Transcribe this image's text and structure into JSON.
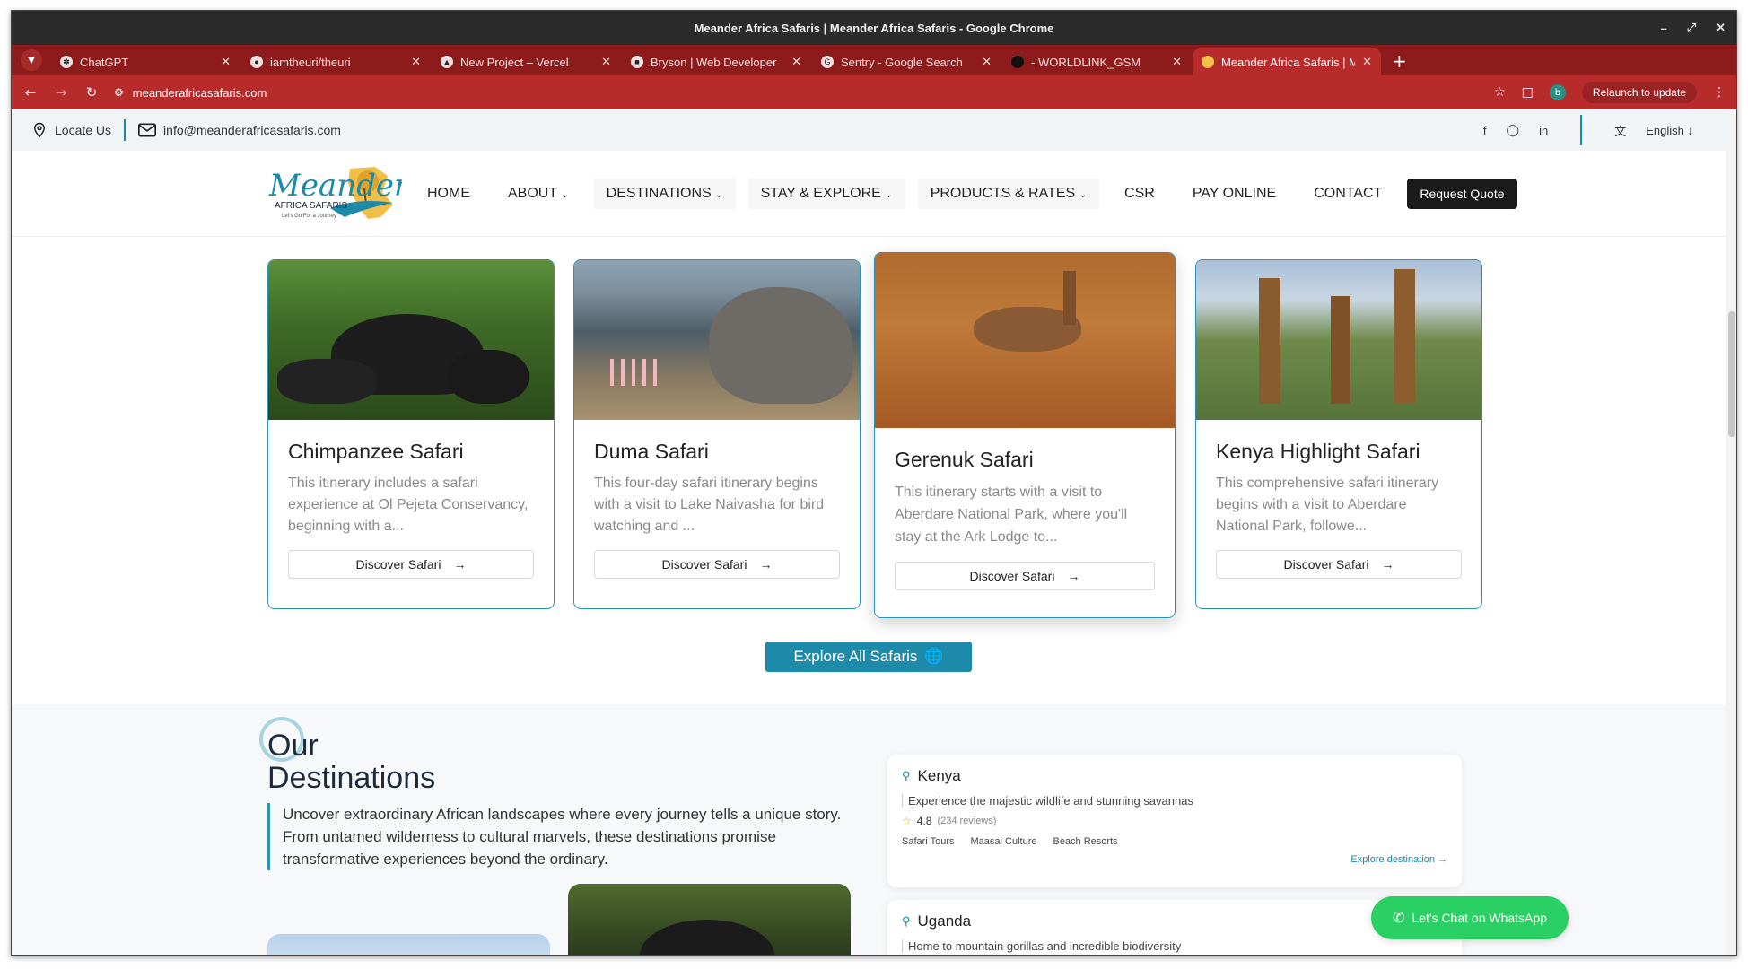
{
  "window": {
    "title": "Meander Africa Safaris | Meander Africa Safaris - Google Chrome"
  },
  "tabs": [
    {
      "label": "ChatGPT",
      "icon": "chatgpt-icon"
    },
    {
      "label": "iamtheuri/theuri",
      "icon": "github-icon"
    },
    {
      "label": "New Project – Vercel",
      "icon": "vercel-icon"
    },
    {
      "label": "Bryson | Web Developer",
      "icon": "site-icon"
    },
    {
      "label": "Sentry - Google Search",
      "icon": "google-icon"
    },
    {
      "label": "- WORLDLINK_GSM",
      "icon": "site-icon"
    },
    {
      "label": "Meander Africa Safaris | M",
      "icon": "meander-icon",
      "active": true
    }
  ],
  "address": {
    "url": "meanderafricasafaris.com",
    "relaunch": "Relaunch to update",
    "profile": "b"
  },
  "topbar": {
    "locate": "Locate Us",
    "email": "info@meanderafricasafaris.com",
    "language": "English"
  },
  "nav": {
    "home": "HOME",
    "about": "ABOUT",
    "destinations": "DESTINATIONS",
    "stay": "STAY & EXPLORE",
    "products": "PRODUCTS & RATES",
    "csr": "CSR",
    "pay": "PAY ONLINE",
    "contact": "CONTACT",
    "quote": "Request Quote"
  },
  "cards": [
    {
      "title": "Chimpanzee Safari",
      "desc": "This itinerary includes a safari experience at Ol Pejeta Conservancy, beginning with a...",
      "button": "Discover Safari"
    },
    {
      "title": "Duma Safari",
      "desc": "This four-day safari itinerary begins with a visit to Lake Naivasha for bird watching and ...",
      "button": "Discover Safari"
    },
    {
      "title": "Gerenuk Safari",
      "desc": "This itinerary starts with a visit to Aberdare National Park, where you'll stay at the Ark Lodge to...",
      "button": "Discover Safari"
    },
    {
      "title": "Kenya Highlight Safari",
      "desc": "This comprehensive safari itinerary begins with a visit to Aberdare National Park, followe...",
      "button": "Discover Safari"
    }
  ],
  "explore_all": "Explore All Safaris",
  "destinations": {
    "title_line1": "Our",
    "title_line2": "Destinations",
    "desc": "Uncover extraordinary African landscapes where every journey tells a unique story. From untamed wilderness to cultural marvels, these destinations promise transformative experiences beyond the ordinary.",
    "items": [
      {
        "name": "Kenya",
        "sub": "Experience the majestic wildlife and stunning savannas",
        "rating": "4.8",
        "reviews": "(234 reviews)",
        "tags": [
          "Safari Tours",
          "Maasai Culture",
          "Beach Resorts"
        ],
        "link": "Explore destination"
      },
      {
        "name": "Uganda",
        "sub": "Home to mountain gorillas and incredible biodiversity"
      }
    ]
  },
  "whatsapp": "Let's Chat on WhatsApp",
  "colors": {
    "brand_teal": "#1c8aa8",
    "chrome_red": "#b82b2b",
    "whatsapp_green": "#2bd064"
  }
}
